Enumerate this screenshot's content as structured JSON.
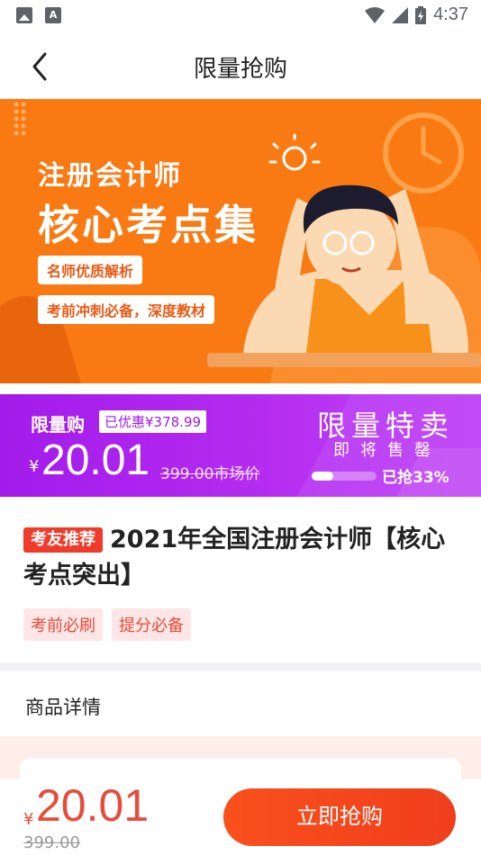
{
  "status_bar": {
    "time": "4:37"
  },
  "navbar": {
    "title": "限量抢购"
  },
  "banner": {
    "title_small": "注册会计师",
    "title_big": "核心考点集",
    "tag1": "名师优质解析",
    "tag2": "考前冲刺必备，深度教材"
  },
  "flash_sale": {
    "label": "限量购",
    "discount": "已优惠¥378.99",
    "currency": "¥",
    "price": "20.01",
    "original": "399.00市场价",
    "right_title": "限量特卖",
    "right_subtitle": "即将售罄",
    "progress": 0.33,
    "progress_text": "已抢33%"
  },
  "product": {
    "badge": "考友推荐",
    "title": "2021年全国注册会计师【核心考点突出】",
    "tags": [
      "考前必刷",
      "提分必备"
    ]
  },
  "detail": {
    "title": "商品详情"
  },
  "bottom_bar": {
    "currency": "¥",
    "price": "20.01",
    "original": "399.00",
    "buy_label": "立即抢购"
  },
  "colors": {
    "banner_orange": "#f97a13",
    "flash_purple": "#a21bea",
    "accent_red": "#f03a2a",
    "buy_button": "#f9501c"
  }
}
